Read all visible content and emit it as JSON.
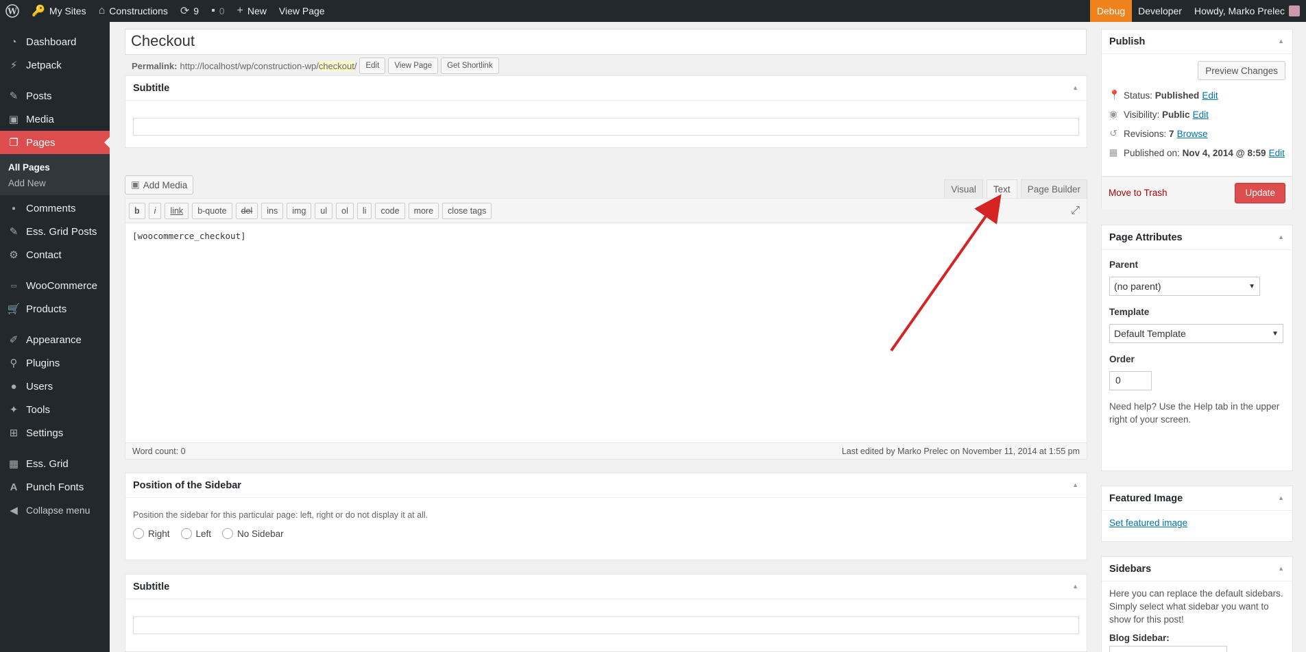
{
  "adminbar": {
    "my_sites": "My Sites",
    "site_name": "Constructions",
    "updates_count": "9",
    "comments_count": "0",
    "new_label": "New",
    "view_page": "View Page",
    "debug": "Debug",
    "developer": "Developer",
    "howdy": "Howdy, Marko Prelec"
  },
  "menu": {
    "dashboard": "Dashboard",
    "jetpack": "Jetpack",
    "posts": "Posts",
    "media": "Media",
    "pages": "Pages",
    "all_pages": "All Pages",
    "add_new": "Add New",
    "comments": "Comments",
    "ess_grid_posts": "Ess. Grid Posts",
    "contact": "Contact",
    "woocommerce": "WooCommerce",
    "products": "Products",
    "appearance": "Appearance",
    "plugins": "Plugins",
    "users": "Users",
    "tools": "Tools",
    "settings": "Settings",
    "ess_grid": "Ess. Grid",
    "punch_fonts": "Punch Fonts",
    "collapse": "Collapse menu"
  },
  "page": {
    "title": "Checkout",
    "permalink_label": "Permalink:",
    "permalink_base": "http://localhost/wp/construction-wp/",
    "permalink_slug": "checkout",
    "permalink_trail": "/",
    "edit_btn": "Edit",
    "view_page_btn": "View Page",
    "shortlink_btn": "Get Shortlink"
  },
  "subtitle_box": {
    "title": "Subtitle"
  },
  "editor": {
    "add_media": "Add Media",
    "tab_visual": "Visual",
    "tab_text": "Text",
    "tab_builder": "Page Builder",
    "quicktags": [
      "b",
      "i",
      "link",
      "b-quote",
      "del",
      "ins",
      "img",
      "ul",
      "ol",
      "li",
      "code",
      "more",
      "close tags"
    ],
    "content": "[woocommerce_checkout]",
    "word_count": "Word count: 0",
    "last_edited": "Last edited by Marko Prelec on November 11, 2014 at 1:55 pm"
  },
  "sidebar_position": {
    "title": "Position of the Sidebar",
    "description": "Position the sidebar for this particular page: left, right or do not display it at all.",
    "options": [
      "Right",
      "Left",
      "No Sidebar"
    ]
  },
  "subtitle_box2": {
    "title": "Subtitle"
  },
  "publish": {
    "title": "Publish",
    "preview": "Preview Changes",
    "status_label": "Status:",
    "status_value": "Published",
    "visibility_label": "Visibility:",
    "visibility_value": "Public",
    "revisions_label": "Revisions:",
    "revisions_value": "7",
    "browse": "Browse",
    "published_label": "Published on:",
    "published_value": "Nov 4, 2014 @ 8:59",
    "edit": "Edit",
    "trash": "Move to Trash",
    "update": "Update"
  },
  "attributes": {
    "title": "Page Attributes",
    "parent_label": "Parent",
    "parent_value": "(no parent)",
    "template_label": "Template",
    "template_value": "Default Template",
    "order_label": "Order",
    "order_value": "0",
    "help": "Need help? Use the Help tab in the upper right of your screen."
  },
  "featured": {
    "title": "Featured Image",
    "link": "Set featured image"
  },
  "sidebars": {
    "title": "Sidebars",
    "text": "Here you can replace the default sidebars. Simply select what sidebar you want to show for this post!",
    "blog_label": "Blog Sidebar:",
    "blog_value": ""
  },
  "colors": {
    "accent": "#dd4d4d",
    "debug": "#f0821e",
    "menu_bg": "#23282d",
    "arrow": "#d62424"
  }
}
